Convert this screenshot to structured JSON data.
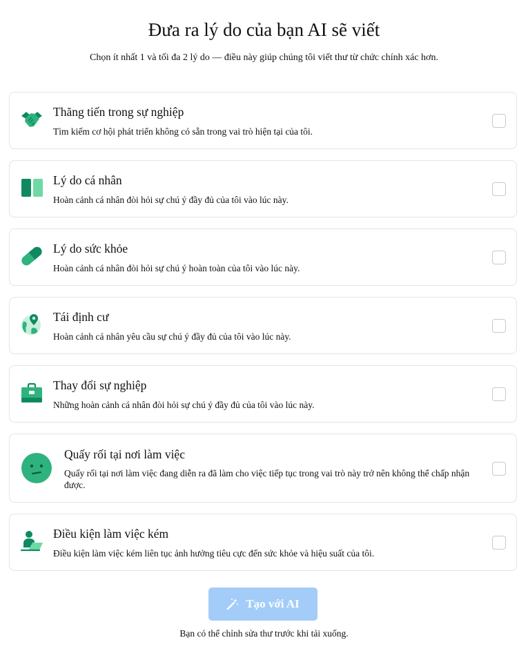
{
  "header": {
    "title": "Đưa ra lý do của bạn AI sẽ viết",
    "subtitle": "Chọn ít nhất 1 và tối đa 2 lý do — điều này giúp chúng tôi viết thư từ chức chính xác hơn."
  },
  "reasons": [
    {
      "icon": "handshake-icon",
      "label": "Thăng tiến trong sự nghiệp",
      "description": "Tìm kiếm cơ hội phát triển không có sẵn trong vai trò hiện tại của tôi.",
      "checked": false
    },
    {
      "icon": "columns-icon",
      "label": "Lý do cá nhân",
      "description": "Hoàn cảnh cá nhân đòi hỏi sự chú ý đầy đủ của tôi vào lúc này.",
      "checked": false
    },
    {
      "icon": "pill-icon",
      "label": "Lý do sức khỏe",
      "description": "Hoàn cảnh cá nhân đòi hỏi sự chú ý hoàn toàn của tôi vào lúc này.",
      "checked": false
    },
    {
      "icon": "globe-location-icon",
      "label": "Tái định cư",
      "description": "Hoàn cảnh cá nhân yêu cầu sự chú ý đầy đủ của tôi vào lúc này.",
      "checked": false
    },
    {
      "icon": "briefcase-icon",
      "label": "Thay đổi sự nghiệp",
      "description": "Những hoàn cảnh cá nhân đòi hỏi sự chú ý đầy đủ của tôi vào lúc này.",
      "checked": false
    },
    {
      "icon": "uneasy-face-icon",
      "label": "Quấy rối tại nơi làm việc",
      "description": "Quấy rối tại nơi làm việc đang diễn ra đã làm cho việc tiếp tục trong vai trò này trở nên không thể chấp nhận được.",
      "checked": false
    },
    {
      "icon": "person-laptop-icon",
      "label": "Điều kiện làm việc kém",
      "description": "Điều kiện làm việc kém liên tục ảnh hưởng tiêu cực đến sức khỏe và hiệu suất của tôi.",
      "checked": false
    }
  ],
  "actions": {
    "generate_label": "Tạo với AI",
    "generate_icon": "magic-wand-icon",
    "footnote": "Bạn có thể chỉnh sửa thư trước khi tải xuống."
  },
  "colors": {
    "accent_dark": "#0f8a5f",
    "accent_mid": "#2fb37e",
    "accent_light": "#6fd9a6",
    "button_disabled": "#a3cdf8",
    "card_border": "#e4e4e7"
  }
}
